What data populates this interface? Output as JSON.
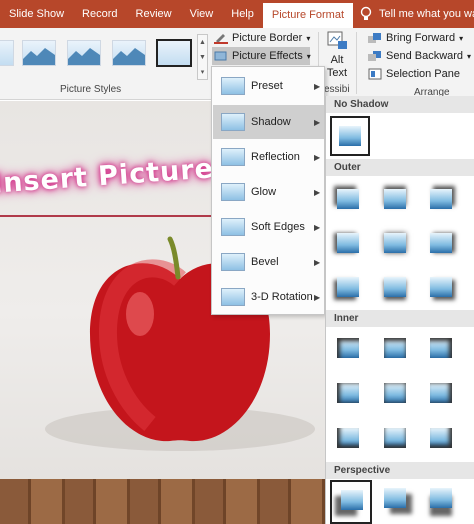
{
  "tabs": [
    "Slide Show",
    "Record",
    "Review",
    "View",
    "Help",
    "Picture Format"
  ],
  "active_tab": "Picture Format",
  "tell_me": "Tell me what you want to",
  "ribbon": {
    "picture_border": "Picture Border",
    "picture_effects": "Picture Effects",
    "alt_text": "Alt Text",
    "accessibility_cut": "essibi",
    "bring_forward": "Bring Forward",
    "send_backward": "Send Backward",
    "selection_pane": "Selection Pane",
    "picture_styles": "Picture Styles",
    "arrange": "Arrange"
  },
  "slide": {
    "title": "Insert Picture"
  },
  "effects_menu": [
    {
      "label": "Preset"
    },
    {
      "label": "Shadow"
    },
    {
      "label": "Reflection"
    },
    {
      "label": "Glow"
    },
    {
      "label": "Soft Edges"
    },
    {
      "label": "Bevel"
    },
    {
      "label": "3-D Rotation"
    }
  ],
  "shadow_gallery": {
    "no_shadow": "No Shadow",
    "outer": "Outer",
    "inner": "Inner",
    "perspective": "Perspective"
  },
  "colors": {
    "ribbon_tab": "#b7472a",
    "glow": "#d2378c"
  }
}
